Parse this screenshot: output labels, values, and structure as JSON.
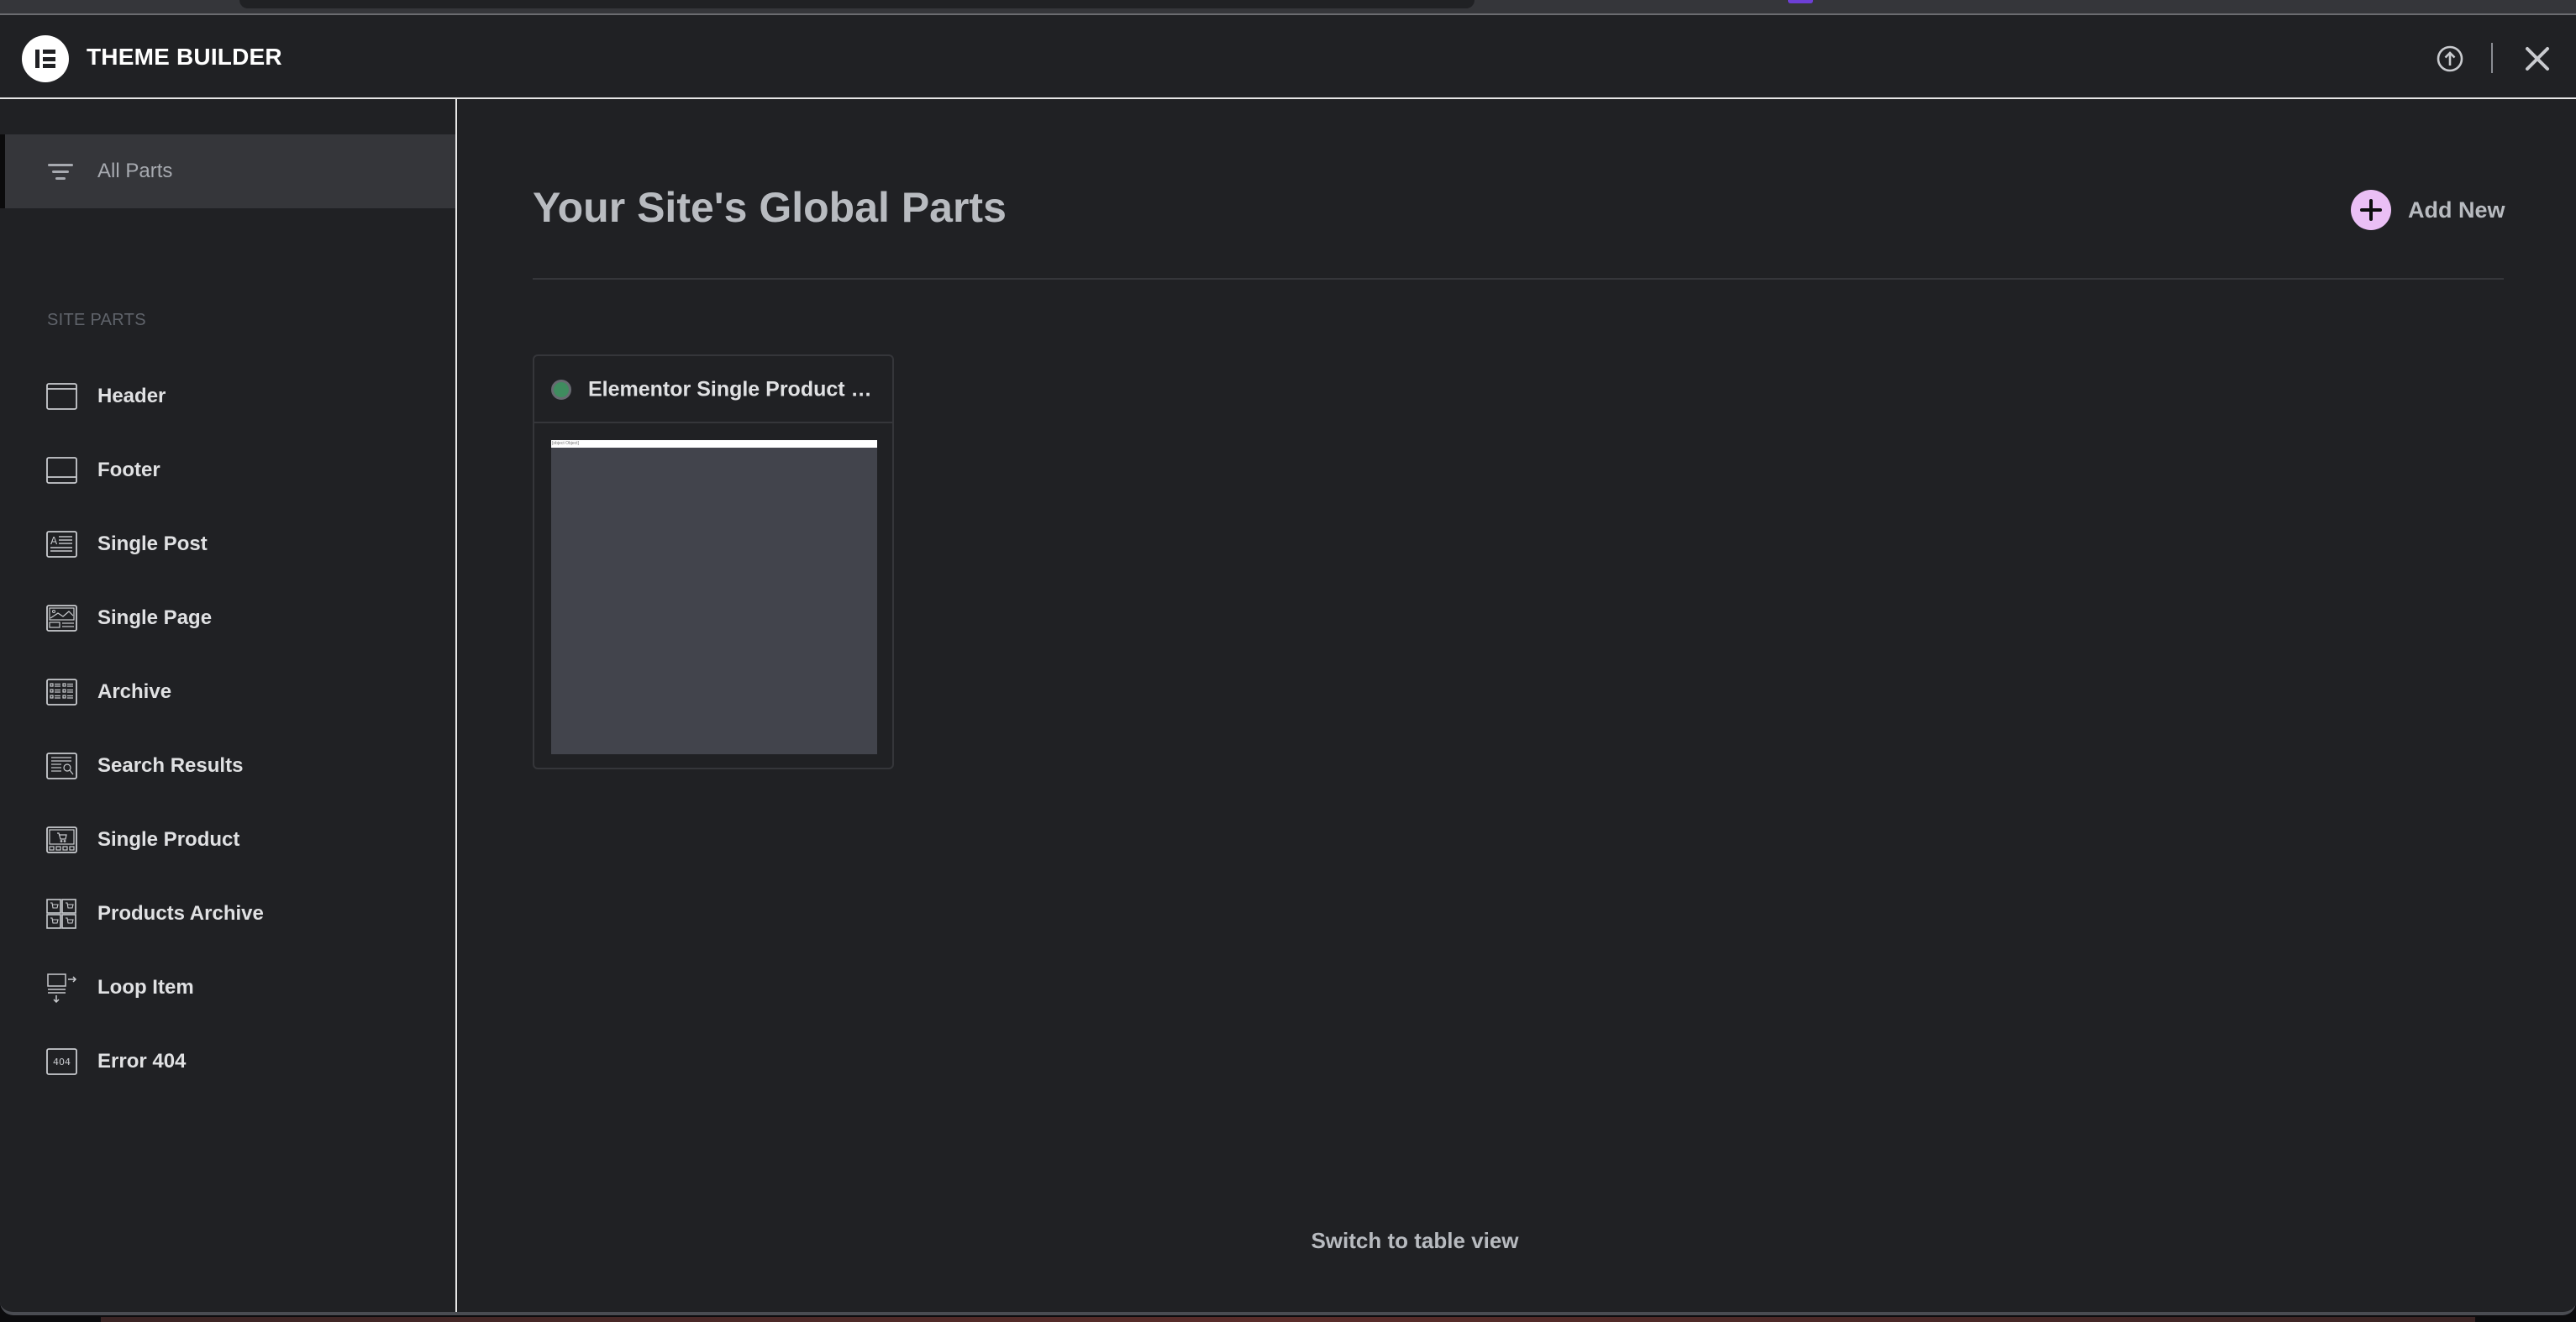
{
  "header": {
    "logo_icon": "elementor-logo-icon",
    "title": "THEME BUILDER",
    "actions": [
      {
        "name": "upload-icon",
        "label": "Upload"
      },
      {
        "name": "close-icon",
        "label": "Close"
      }
    ]
  },
  "sidebar": {
    "all_parts": {
      "label": "All Parts",
      "icon": "filter-icon",
      "active": true
    },
    "section_title": "SITE PARTS",
    "items": [
      {
        "label": "Header",
        "icon": "header-icon"
      },
      {
        "label": "Footer",
        "icon": "footer-icon"
      },
      {
        "label": "Single Post",
        "icon": "single-post-icon"
      },
      {
        "label": "Single Page",
        "icon": "single-page-icon"
      },
      {
        "label": "Archive",
        "icon": "archive-icon"
      },
      {
        "label": "Search Results",
        "icon": "search-results-icon"
      },
      {
        "label": "Single Product",
        "icon": "single-product-icon"
      },
      {
        "label": "Products Archive",
        "icon": "products-archive-icon"
      },
      {
        "label": "Loop Item",
        "icon": "loop-item-icon"
      },
      {
        "label": "Error 404",
        "icon": "error-404-icon"
      }
    ]
  },
  "main": {
    "title": "Your Site's Global Parts",
    "add_new_label": "Add New",
    "cards": [
      {
        "title": "Elementor Single Product #...",
        "status": "active",
        "status_color": "#3f8c5f",
        "thumbnail_text": "[object Object]"
      }
    ],
    "switch_view_label": "Switch to table view"
  },
  "colors": {
    "background": "#202124",
    "accent_add": "#eabff5",
    "active_item_bg": "#35363a"
  }
}
